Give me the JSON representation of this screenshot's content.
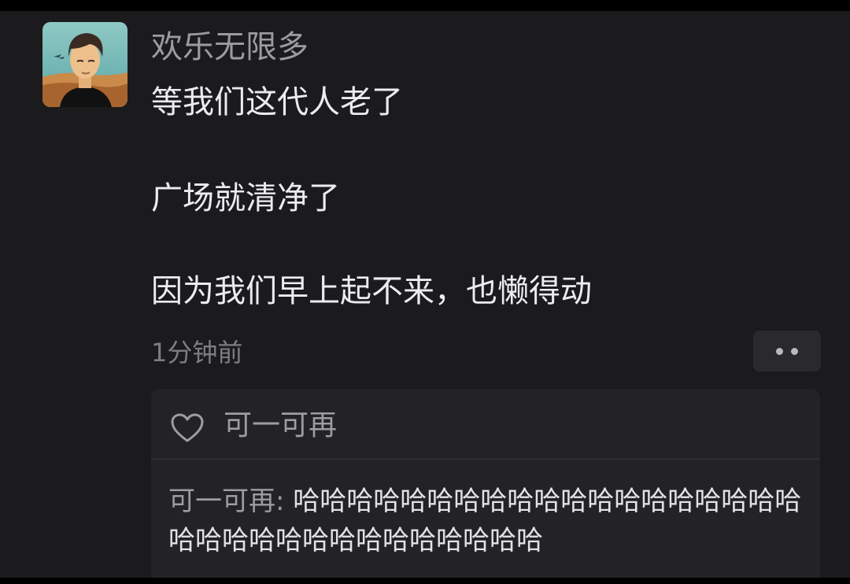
{
  "post": {
    "username": "欢乐无限多",
    "lines": [
      "等我们这代人老了",
      "广场就清净了",
      "因为我们早上起不来，也懒得动"
    ],
    "timestamp": "1分钟前"
  },
  "likes": {
    "names": "可一可再"
  },
  "comments": [
    {
      "author": "可一可再:",
      "text": "哈哈哈哈哈哈哈哈哈哈哈哈哈哈哈哈哈哈哈哈哈哈哈哈哈哈哈哈哈哈哈哈哈"
    }
  ],
  "icons": {
    "more": "more-dots-icon",
    "like": "heart-outline-icon"
  },
  "colors": {
    "background": "#1b1b1d",
    "username": "#9b9ba2",
    "text": "#ececee",
    "card": "#232326"
  }
}
